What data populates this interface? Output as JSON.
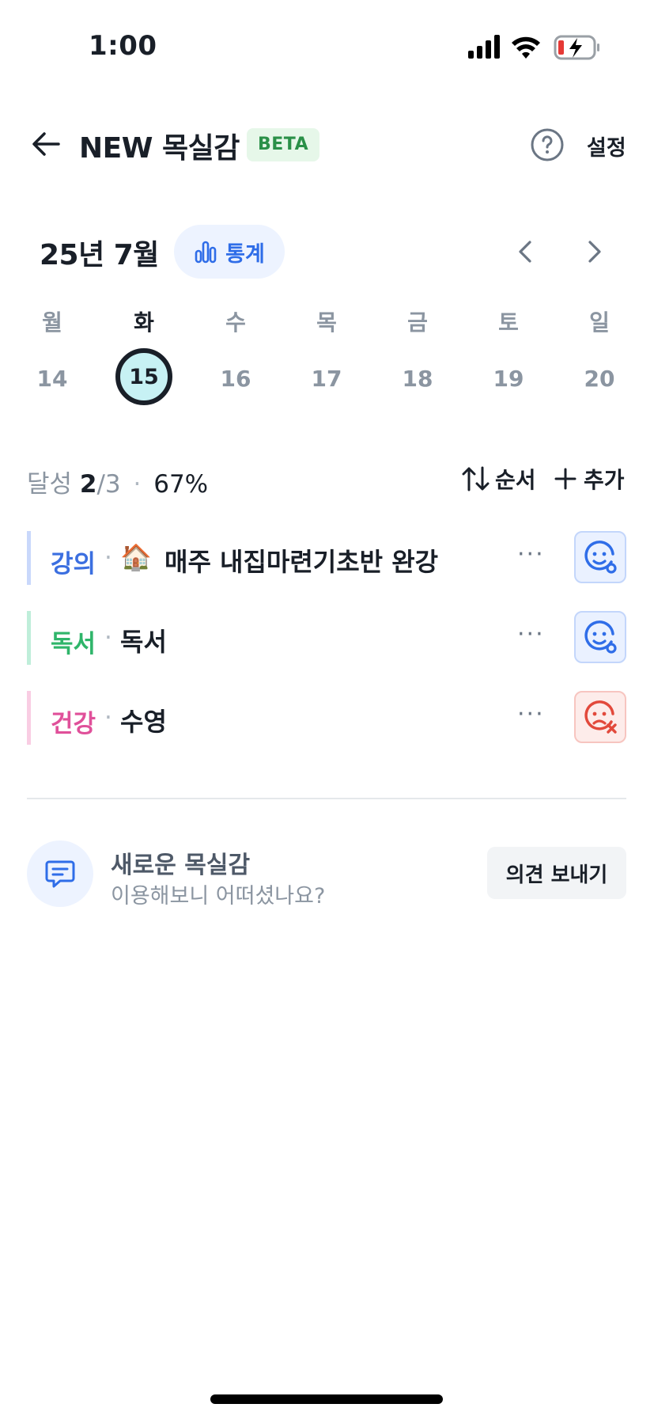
{
  "status_bar": {
    "time": "1:00"
  },
  "header": {
    "title": "NEW 목실감",
    "badge": "BETA",
    "settings_label": "설정"
  },
  "calendar": {
    "month_label": "25년 7월",
    "stats_label": "통계",
    "weekdays": [
      "월",
      "화",
      "수",
      "목",
      "금",
      "토",
      "일"
    ],
    "days": [
      "14",
      "15",
      "16",
      "17",
      "18",
      "19",
      "20"
    ],
    "selected_index": 1
  },
  "summary": {
    "label": "달성",
    "done": "2",
    "total": "/3",
    "dot": "·",
    "percent": "67%",
    "order_label": "순서",
    "add_label": "추가"
  },
  "goals": [
    {
      "category": "강의",
      "category_color": "#3b6fe0",
      "bar_color": "#c9d8fb",
      "emoji": "🏠",
      "name": "매주 내집마련기초반 완강",
      "status": "ok"
    },
    {
      "category": "독서",
      "category_color": "#2fb56a",
      "bar_color": "#bfeeda",
      "emoji": "",
      "name": "독서",
      "status": "ok"
    },
    {
      "category": "건강",
      "category_color": "#e0509a",
      "bar_color": "#f9cde3",
      "emoji": "",
      "name": "수영",
      "status": "fail"
    }
  ],
  "goal_sep": "·",
  "goal_more": "···",
  "feedback": {
    "title": "새로운 목실감",
    "subtitle": "이용해보니 어떠셨나요?",
    "button": "의견 보내기"
  },
  "colors": {
    "accent": "#2f6de8",
    "success": "#2a9048",
    "fail": "#e2493b"
  }
}
